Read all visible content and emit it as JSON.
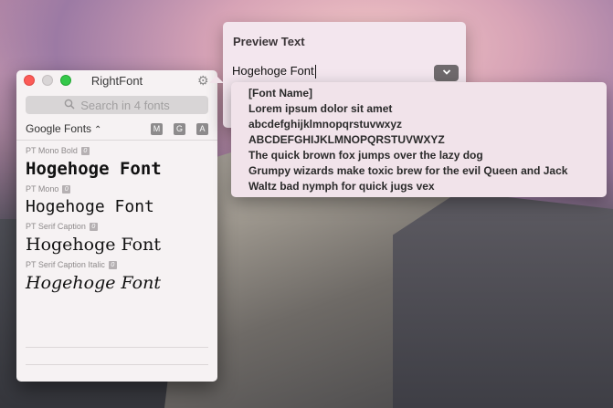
{
  "window": {
    "title": "RightFont",
    "search_placeholder": "Search in 4 fonts",
    "source_label": "Google Fonts",
    "source_chevron": "⌃⌄",
    "filters": [
      "M",
      "G",
      "A"
    ],
    "fonts": [
      {
        "name": "PT Mono Bold",
        "sample": "Hogehoge Font"
      },
      {
        "name": "PT Mono",
        "sample": "Hogehoge Font"
      },
      {
        "name": "PT Serif Caption",
        "sample": "Hogehoge Font"
      },
      {
        "name": "PT Serif Caption Italic",
        "sample": "Hogehoge Font"
      }
    ]
  },
  "preview": {
    "title": "Preview Text",
    "input_value": "Hogehoge Font"
  },
  "dropdown": {
    "items": [
      "[Font Name]",
      "Lorem ipsum dolor sit amet",
      "abcdefghijklmnopqrstuvwxyz",
      "ABCDEFGHIJKLMNOPQRSTUVWXYZ",
      "The quick brown fox jumps over the lazy dog",
      "Grumpy wizards make toxic brew for the evil Queen and Jack",
      "Waltz bad nymph for quick jugs vex"
    ]
  },
  "icons": {
    "gear": "gear-icon",
    "search": "search-icon",
    "dropdown": "chevron-down-icon"
  },
  "colors": {
    "close": "#fc5b57",
    "maximize": "#35c84a",
    "badge": "#8d8b8c"
  }
}
